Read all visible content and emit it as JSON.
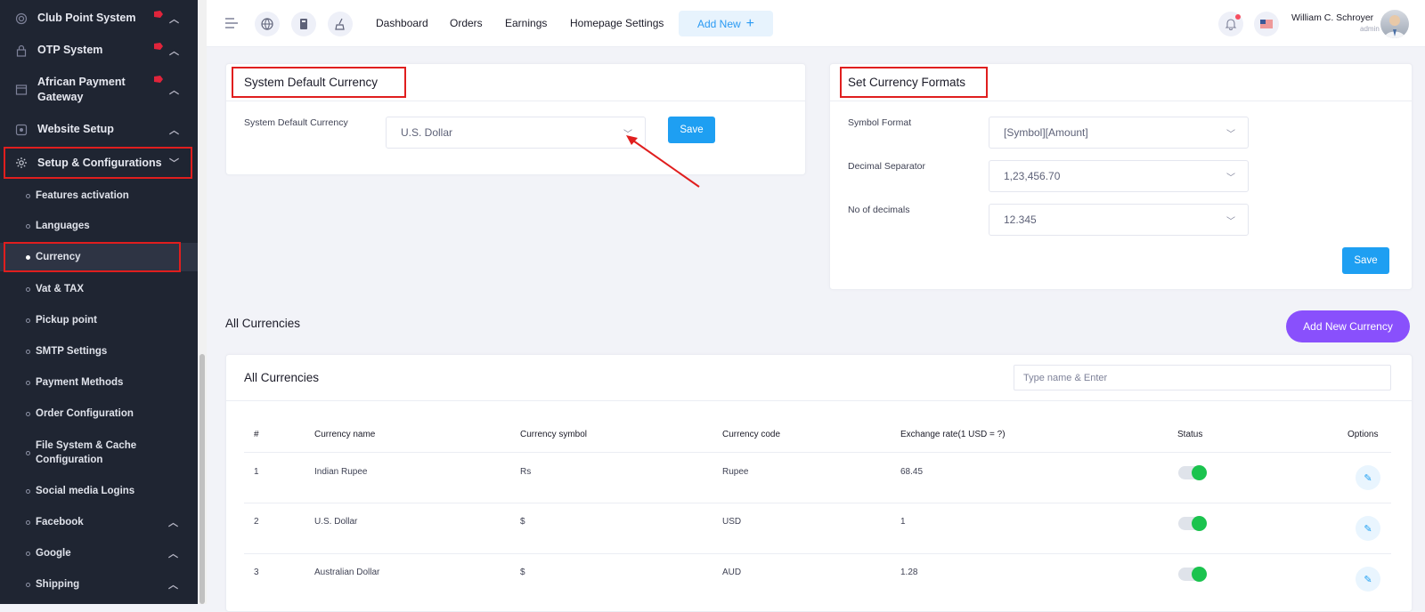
{
  "sidebar": {
    "items": [
      {
        "label": "Club Point System",
        "icon": "club-point-icon",
        "chevron": "up",
        "badge": true
      },
      {
        "label": "OTP System",
        "icon": "otp-icon",
        "chevron": "up",
        "badge": true
      },
      {
        "label": "African Payment Gateway",
        "icon": "payment-gateway-icon",
        "chevron": "up",
        "badge": true
      },
      {
        "label": "Website Setup",
        "icon": "website-setup-icon",
        "chevron": "up",
        "badge": false
      },
      {
        "label": "Setup & Configurations",
        "icon": "setup-config-icon",
        "chevron": "down",
        "badge": false
      }
    ],
    "sub_items": [
      {
        "label": "Features activation",
        "active": false
      },
      {
        "label": "Languages",
        "active": false
      },
      {
        "label": "Currency",
        "active": true
      },
      {
        "label": "Vat & TAX",
        "active": false
      },
      {
        "label": "Pickup point",
        "active": false
      },
      {
        "label": "SMTP Settings",
        "active": false
      },
      {
        "label": "Payment Methods",
        "active": false
      },
      {
        "label": "Order Configuration",
        "active": false
      },
      {
        "label": "File System & Cache Configuration",
        "active": false
      },
      {
        "label": "Social media Logins",
        "active": false
      },
      {
        "label": "Facebook",
        "active": false,
        "chevron": "up"
      },
      {
        "label": "Google",
        "active": false,
        "chevron": "up"
      },
      {
        "label": "Shipping",
        "active": false,
        "chevron": "up"
      }
    ]
  },
  "topbar": {
    "links": [
      "Dashboard",
      "Orders",
      "Earnings",
      "Homepage Settings"
    ],
    "add_new": "Add New",
    "user_name": "William C. Schroyer",
    "user_role": "admin"
  },
  "default_currency": {
    "title": "System Default Currency",
    "label": "System Default Currency",
    "value": "U.S. Dollar",
    "save": "Save"
  },
  "formats": {
    "title": "Set Currency Formats",
    "symbol_label": "Symbol Format",
    "symbol_value": "[Symbol][Amount]",
    "decimal_label": "Decimal Separator",
    "decimal_value": "1,23,456.70",
    "decimals_label": "No of decimals",
    "decimals_value": "12.345",
    "save": "Save"
  },
  "all_currencies": {
    "section_label": "All Currencies",
    "add_button": "Add New Currency",
    "card_title": "All Currencies",
    "search_placeholder": "Type name & Enter",
    "columns": [
      "#",
      "Currency name",
      "Currency symbol",
      "Currency code",
      "Exchange rate(1 USD = ?)",
      "Status",
      "Options"
    ],
    "rows": [
      {
        "num": "1",
        "name": "Indian Rupee",
        "symbol": "Rs",
        "code": "Rupee",
        "rate": "68.45",
        "status": true
      },
      {
        "num": "2",
        "name": "U.S. Dollar",
        "symbol": "$",
        "code": "USD",
        "rate": "1",
        "status": true
      },
      {
        "num": "3",
        "name": "Australian Dollar",
        "symbol": "$",
        "code": "AUD",
        "rate": "1.28",
        "status": true
      }
    ]
  },
  "colors": {
    "sidebar_bg": "#1f2532",
    "primary": "#1e9ff2",
    "purple": "#8950fc",
    "success": "#1bc34e",
    "annotation_red": "#e01e1e"
  }
}
